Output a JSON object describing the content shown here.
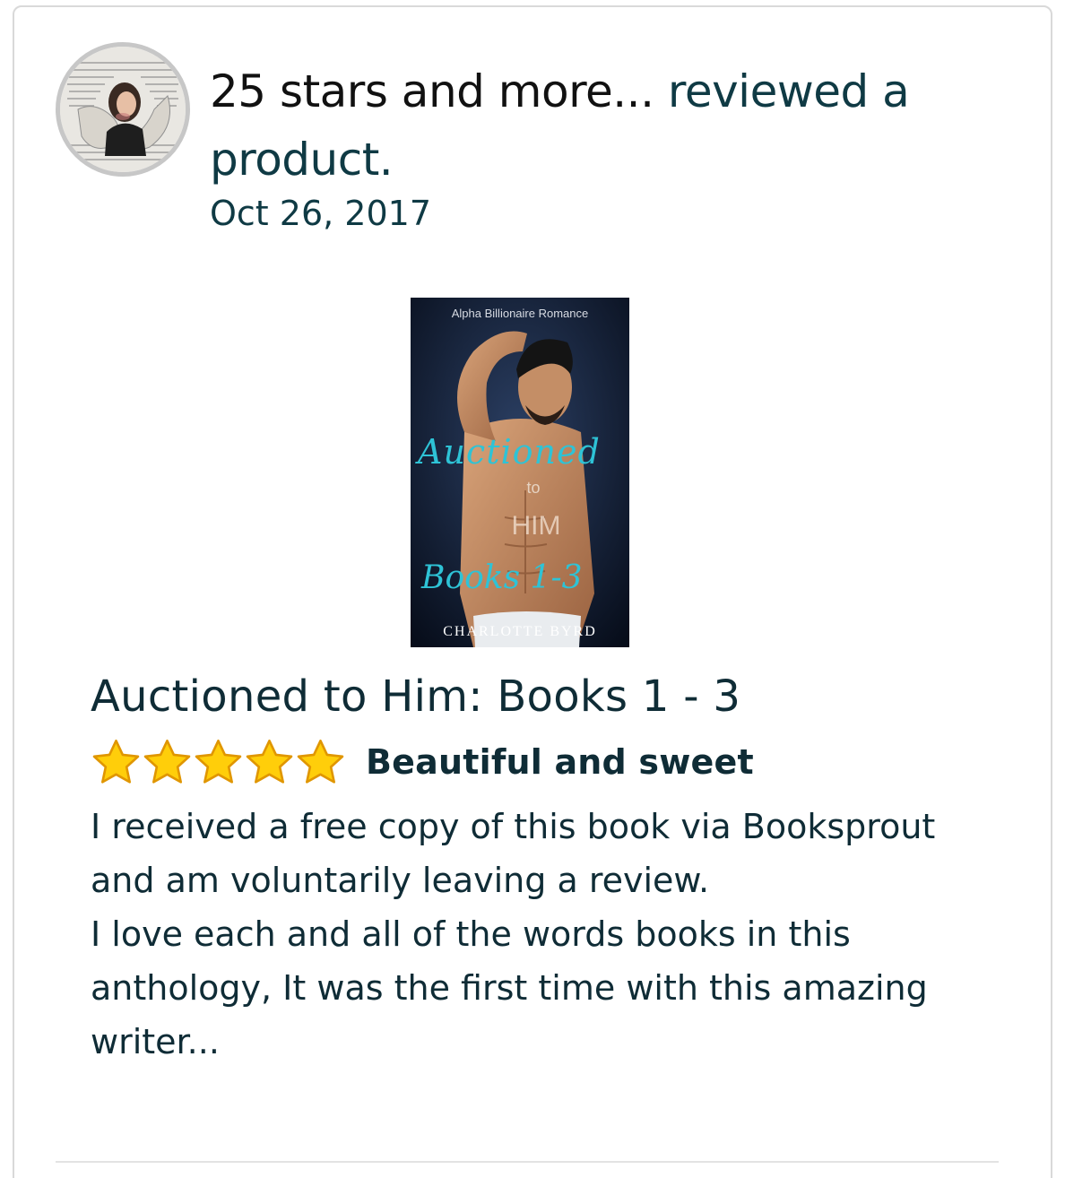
{
  "review": {
    "reviewer_name": "25 stars and more...",
    "action_text": " reviewed a product.",
    "date": "Oct 26, 2017",
    "product": {
      "title": "Auctioned to Him: Books 1 - 3",
      "cover": {
        "tagline": "Alpha Billionaire Romance",
        "title_script": "Auctioned",
        "title_to": "to",
        "title_him": "HIM",
        "series": "Books 1-3",
        "author": "CHARLOTTE BYRD"
      }
    },
    "rating": 5,
    "rating_max": 5,
    "headline": "Beautiful and sweet",
    "body_paragraphs": [
      "I received a free copy of this book via Booksprout and am voluntarily leaving a review.",
      "I love each and all of the words books in this anthology, It was the first time with this amazing writer..."
    ]
  },
  "colors": {
    "text": "#0f2c36",
    "star_fill": "#ffce0a",
    "star_stroke": "#e09600",
    "cover_accent": "#2ec3d6",
    "border": "#d9d9d9"
  },
  "icons": {
    "star": "star-icon",
    "avatar": "avatar-image"
  }
}
